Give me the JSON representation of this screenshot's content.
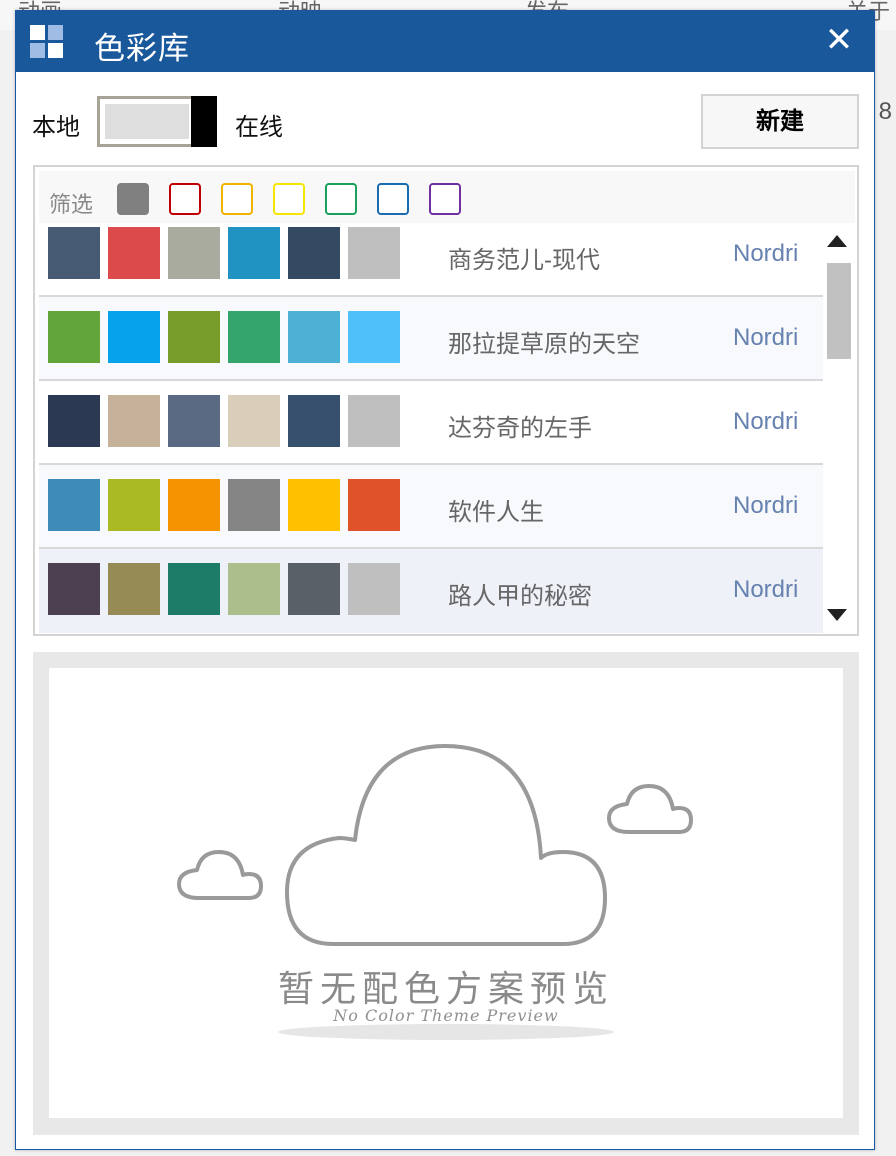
{
  "background": {
    "tabs": [
      "动画",
      "动映",
      "发布",
      "关于"
    ],
    "right_fragment": "8"
  },
  "dialog": {
    "title": "色彩库",
    "icon": "grid-icon",
    "close_icon": "close-icon",
    "close_glyph": "✕"
  },
  "source_toggle": {
    "local_label": "本地",
    "online_label": "在线",
    "state": "online"
  },
  "new_button": {
    "label": "新建"
  },
  "filter": {
    "label": "筛选",
    "colors": [
      "#808080",
      "#c00000",
      "#f0b400",
      "#f5e600",
      "#1aa05a",
      "#1a6cb0",
      "#7030a0"
    ]
  },
  "themes": [
    {
      "name": "商务范儿-现代",
      "author": "Nordri",
      "colors": [
        "#475a74",
        "#dc4a4b",
        "#a9ab9e",
        "#2093c3",
        "#344a62",
        "#bfbfbf"
      ]
    },
    {
      "name": "那拉提草原的天空",
      "author": "Nordri",
      "colors": [
        "#62a63a",
        "#07a3ea",
        "#779c2a",
        "#34a66d",
        "#4db0d5",
        "#50c1f8"
      ]
    },
    {
      "name": "达芬奇的左手",
      "author": "Nordri",
      "colors": [
        "#2b3a52",
        "#c6b29b",
        "#5a6a82",
        "#d8ceba",
        "#37506e",
        "#bfbfbf"
      ]
    },
    {
      "name": "软件人生",
      "author": "Nordri",
      "colors": [
        "#3c8bb9",
        "#a9ba22",
        "#f59300",
        "#848484",
        "#ffc000",
        "#e0532a"
      ]
    },
    {
      "name": "路人甲的秘密",
      "author": "Nordri",
      "colors": [
        "#4c4050",
        "#968b55",
        "#1d7c67",
        "#abbe8c",
        "#5a6068",
        "#bfbfbf"
      ]
    }
  ],
  "preview": {
    "empty_title": "暂无配色方案预览",
    "empty_subtitle": "No Color Theme Preview"
  }
}
